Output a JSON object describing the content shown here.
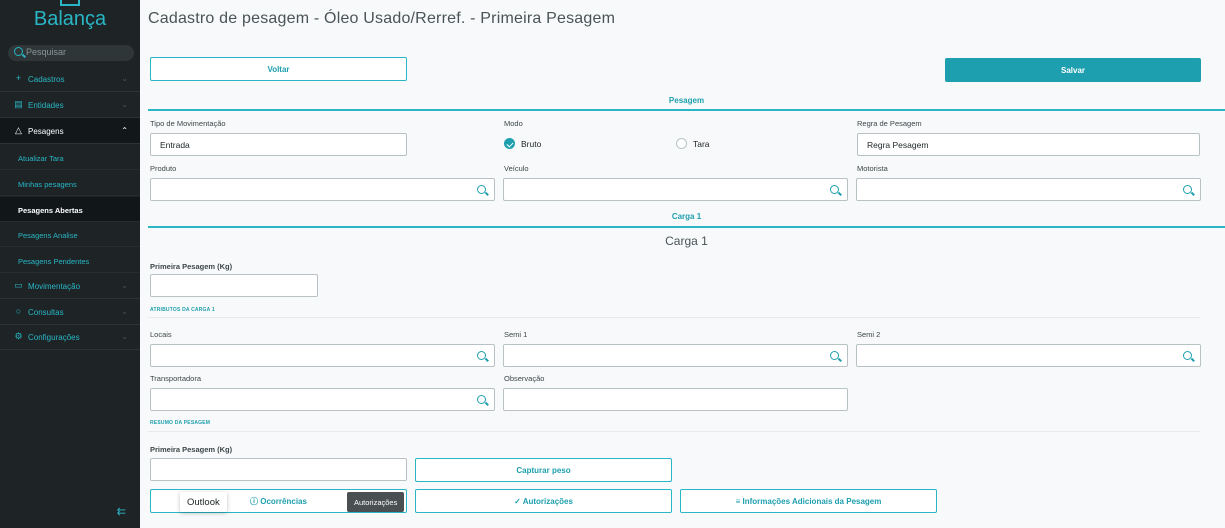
{
  "app": {
    "name": "Balança"
  },
  "sidebar": {
    "search_placeholder": "Pesquisar",
    "items": [
      {
        "label": "Cadastros",
        "icon": "plus-icon"
      },
      {
        "label": "Entidades",
        "icon": "database-icon"
      },
      {
        "label": "Pesagens",
        "icon": "scale-icon"
      },
      {
        "label": "Movimentação",
        "icon": "monitor-icon"
      },
      {
        "label": "Consultas",
        "icon": "search-icon"
      },
      {
        "label": "Configurações",
        "icon": "gear-icon"
      }
    ],
    "subitems": [
      {
        "label": "Atualizar Tara"
      },
      {
        "label": "Minhas pesagens"
      },
      {
        "label": "Pesagens Abertas"
      },
      {
        "label": "Pesagens Analise"
      },
      {
        "label": "Pesagens Pendentes"
      }
    ]
  },
  "page": {
    "title": "Cadastro de pesagem - Óleo Usado/Rerref. - Primeira Pesagem",
    "back_label": "Voltar",
    "save_label": "Salvar"
  },
  "pesagem": {
    "section_title": "Pesagem",
    "tipo_label": "Tipo de Movimentação",
    "tipo_value": "Entrada",
    "modo_label": "Modo",
    "modo_options": [
      "Bruto",
      "Tara"
    ],
    "modo_selected": "Bruto",
    "regra_label": "Regra de Pesagem",
    "regra_value": "Regra Pesagem",
    "produto_label": "Produto",
    "veiculo_label": "Veículo",
    "motorista_label": "Motorista"
  },
  "carga": {
    "section_title": "Carga 1",
    "heading": "Carga 1",
    "primeira_label": "Primeira Pesagem (Kg)",
    "atributos_label": "ATRIBUTOS DA CARGA 1",
    "locais_label": "Locais",
    "semi1_label": "Semi 1",
    "semi2_label": "Semi 2",
    "transportadora_label": "Transportadora",
    "observacao_label": "Observação",
    "resumo_label": "RESUMO DA PESAGEM",
    "resumo_primeira_label": "Primeira Pesagem (Kg)",
    "capturar_label": "Capturar peso"
  },
  "footer": {
    "ocorrencias_label": "ⓘ Ocorrências",
    "autorizacoes_label": "✓ Autorizações",
    "info_label": "≡ Informações Adicionais da Pesagem"
  },
  "tooltips": {
    "outlook": "Outlook",
    "autorizacoes": "Autorizações"
  },
  "colors": {
    "accent": "#29b6c5",
    "sidebar_bg": "#1e2426",
    "primary_button": "#1e9fb0"
  }
}
